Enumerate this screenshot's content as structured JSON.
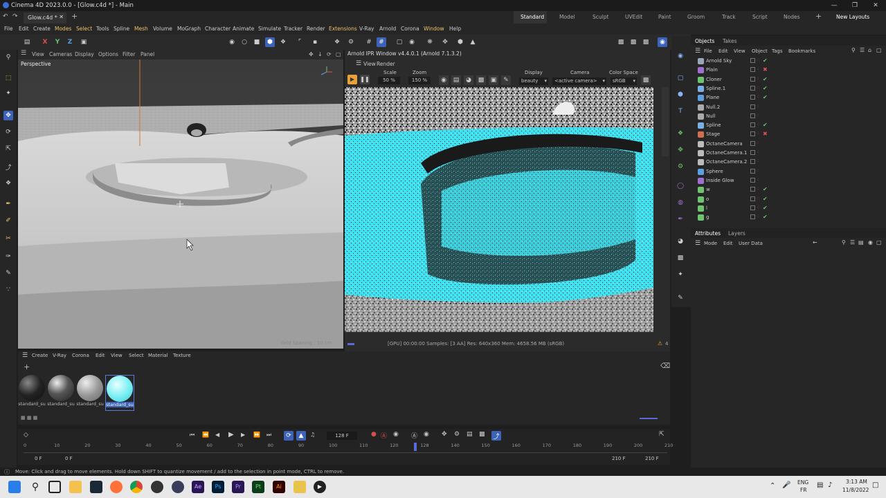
{
  "window": {
    "title": "Cinema 4D 2023.0.0 - [Glow.c4d *] - Main",
    "doc_tab": "Glow.c4d *"
  },
  "workspaces": [
    "Standard",
    "Model",
    "Sculpt",
    "UVEdit",
    "Paint",
    "Groom",
    "Track",
    "Script",
    "Nodes",
    "New Layouts"
  ],
  "menu": [
    "File",
    "Edit",
    "Create",
    "Modes",
    "Select",
    "Tools",
    "Spline",
    "Mesh",
    "Volume",
    "MoGraph",
    "Character",
    "Animate",
    "Simulate",
    "Tracker",
    "Render",
    "Extensions",
    "V-Ray",
    "Arnold",
    "Corona",
    "Window",
    "Help"
  ],
  "axis_labels": [
    "X",
    "Y",
    "Z"
  ],
  "viewport": {
    "menu": [
      "View",
      "Cameras",
      "Display",
      "Options",
      "Filter",
      "Panel"
    ],
    "label": "Perspective",
    "grid_spacing": "Grid Spacing : 10 cm"
  },
  "ipr": {
    "title": "Arnold IPR Window v4.4.0.1 (Arnold 7.1.3.2)",
    "menu": [
      "View",
      "Render"
    ],
    "scale_label": "Scale",
    "scale_value": "50 %",
    "zoom_label": "Zoom",
    "zoom_value": "150 %",
    "display_label": "Display",
    "display_value": "beauty",
    "camera_label": "Camera",
    "camera_value": "<active camera>",
    "colorspace_label": "Color Space",
    "colorspace_value": "sRGB",
    "status": "[GPU] 00:00:00  Samples: [3 AA]  Res: 640x360  Mem: 4658.56 MB  (sRGB)",
    "warning_count": "4"
  },
  "objects_panel": {
    "tabs": [
      "Objects",
      "Takes"
    ],
    "menu": [
      "File",
      "Edit",
      "View",
      "Object",
      "Tags",
      "Bookmarks"
    ],
    "items": [
      {
        "name": "Arnold Sky",
        "icon_color": "#9aa7b8",
        "check": "green"
      },
      {
        "name": "Plain",
        "icon_color": "#a070d0",
        "check": "red"
      },
      {
        "name": "Cloner",
        "icon_color": "#6ec36e",
        "check": "green"
      },
      {
        "name": "Spline.1",
        "icon_color": "#7ab0e8",
        "check": "green"
      },
      {
        "name": "Plane",
        "icon_color": "#5aa0e0",
        "check": "green"
      },
      {
        "name": "Null.2",
        "icon_color": "#aaaaaa",
        "check": "none"
      },
      {
        "name": "Null",
        "icon_color": "#aaaaaa",
        "check": "none"
      },
      {
        "name": "Spline",
        "icon_color": "#7ab0e8",
        "check": "green"
      },
      {
        "name": "Stage",
        "icon_color": "#d07050",
        "check": "red"
      },
      {
        "name": "OctaneCamera",
        "icon_color": "#bbbbbb",
        "check": "none"
      },
      {
        "name": "OctaneCamera.1",
        "icon_color": "#bbbbbb",
        "check": "none"
      },
      {
        "name": "OctaneCamera.2",
        "icon_color": "#bbbbbb",
        "check": "none"
      },
      {
        "name": "Sphere",
        "icon_color": "#5aa0e0",
        "check": "none"
      },
      {
        "name": "Inside Glow",
        "icon_color": "#a070d0",
        "check": "none"
      },
      {
        "name": "w",
        "icon_color": "#6ec36e",
        "check": "green"
      },
      {
        "name": "o",
        "icon_color": "#6ec36e",
        "check": "green"
      },
      {
        "name": "l",
        "icon_color": "#6ec36e",
        "check": "green"
      },
      {
        "name": "g",
        "icon_color": "#6ec36e",
        "check": "green"
      }
    ]
  },
  "attributes_panel": {
    "tabs": [
      "Attributes",
      "Layers"
    ],
    "menu": [
      "Mode",
      "Edit",
      "User Data"
    ]
  },
  "material_manager": {
    "menu": [
      "Create",
      "V-Ray",
      "Corona",
      "Edit",
      "View",
      "Select",
      "Material",
      "Texture"
    ],
    "materials": [
      "standard_su",
      "standard_su",
      "standard_su",
      "standard_su"
    ]
  },
  "timeline": {
    "current_frame": "128 F",
    "ruler": [
      "0",
      "10",
      "20",
      "30",
      "40",
      "50",
      "60",
      "70",
      "80",
      "90",
      "100",
      "110",
      "120",
      "128",
      "140",
      "150",
      "160",
      "170",
      "180",
      "190",
      "200",
      "210"
    ],
    "start_a": "0 F",
    "start_b": "0 F",
    "end_a": "210 F",
    "end_b": "210 F"
  },
  "status_bar": {
    "text": "Move: Click and drag to move elements. Hold down SHIFT to quantize movement / add to the selection in point mode, CTRL to remove."
  },
  "taskbar": {
    "lang_top": "ENG",
    "lang_bottom": "FR",
    "time": "3:13 AM",
    "date": "11/8/2022"
  },
  "colors": {
    "accent_blue": "#3d63b8",
    "ipr_cyan": "#3fe0f0",
    "menu_highlight": "#e9c46a"
  }
}
